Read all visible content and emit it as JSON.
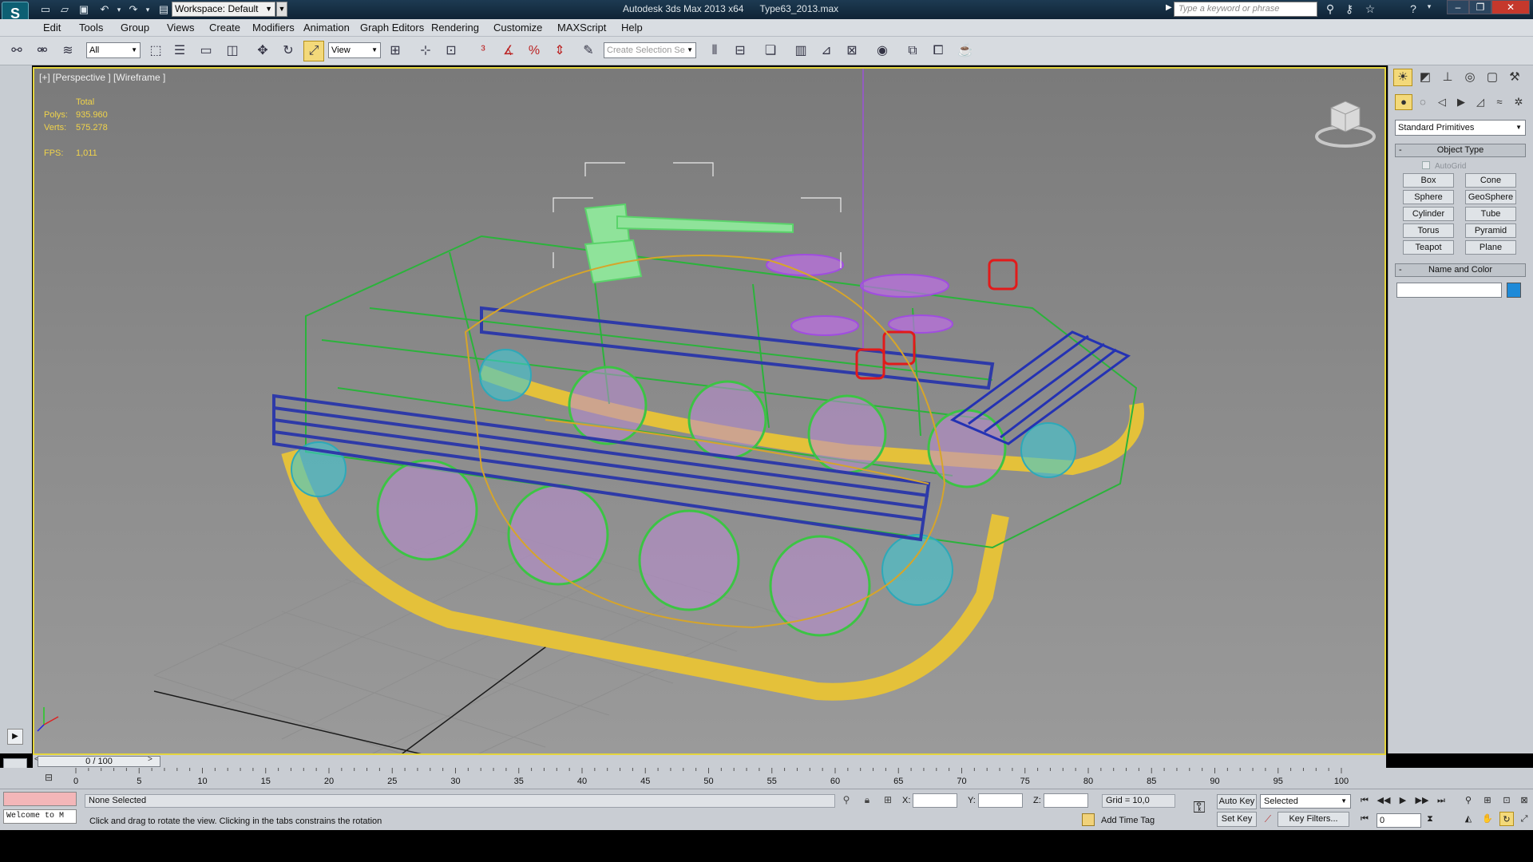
{
  "titlebar": {
    "app_title": "Autodesk 3ds Max  2013 x64",
    "file_name": "Type63_2013.max",
    "workspace": "Workspace: Default",
    "search_placeholder": "Type a keyword or phrase"
  },
  "menu": [
    "Edit",
    "Tools",
    "Group",
    "Views",
    "Create",
    "Modifiers",
    "Animation",
    "Graph Editors",
    "Rendering",
    "Customize",
    "MAXScript",
    "Help"
  ],
  "toolbar": {
    "filter": "All",
    "ref_coord": "View",
    "selection_set_placeholder": "Create Selection Se"
  },
  "viewport": {
    "label": "[+] [Perspective ] [Wireframe ]",
    "stats_header": "Total",
    "polys_label": "Polys:",
    "polys_value": "935.960",
    "verts_label": "Verts:",
    "verts_value": "575.278",
    "fps_label": "FPS:",
    "fps_value": "1,011"
  },
  "command_panel": {
    "primitive_type": "Standard Primitives",
    "object_type_title": "Object Type",
    "autogrid_label": "AutoGrid",
    "buttons": [
      "Box",
      "Cone",
      "Sphere",
      "GeoSphere",
      "Cylinder",
      "Tube",
      "Torus",
      "Pyramid",
      "Teapot",
      "Plane"
    ],
    "name_color_title": "Name and Color",
    "object_color": "#1e8ad8"
  },
  "timeline": {
    "slider_text": "0 / 100",
    "ticks": [
      "0",
      "5",
      "10",
      "15",
      "20",
      "25",
      "30",
      "35",
      "40",
      "45",
      "50",
      "55",
      "60",
      "65",
      "70",
      "75",
      "80",
      "85",
      "90",
      "95",
      "100"
    ]
  },
  "status": {
    "maxscript_text": "Welcome to M",
    "selection_status": "None Selected",
    "prompt": "Click and drag to rotate the view.  Clicking in the tabs constrains the rotation",
    "x_label": "X:",
    "y_label": "Y:",
    "z_label": "Z:",
    "grid": "Grid = 10,0",
    "add_time_tag": "Add Time Tag",
    "auto_key": "Auto Key",
    "set_key": "Set Key",
    "key_mode": "Selected",
    "key_filters": "Key Filters...",
    "current_frame": "0"
  }
}
